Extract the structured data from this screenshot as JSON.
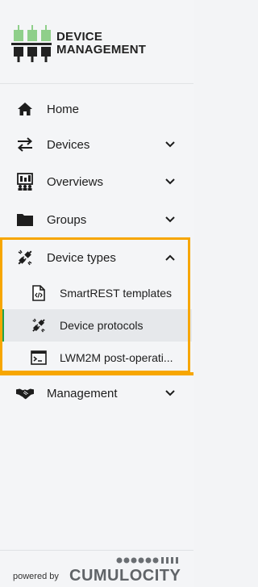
{
  "brand": {
    "line1": "DEVICE",
    "line2": "MANAGEMENT"
  },
  "nav": {
    "home": "Home",
    "devices": "Devices",
    "overviews": "Overviews",
    "groups": "Groups",
    "device_types": "Device types",
    "management": "Management"
  },
  "sub": {
    "smartrest": "SmartREST templates",
    "protocols": "Device protocols",
    "lwm2m": "LWM2M post-operati..."
  },
  "footer": {
    "powered_by": "powered by",
    "logo_word": "CUMULOCITY"
  },
  "colors": {
    "accent": "#22a34a",
    "highlight": "#f7a600",
    "logo_green": "#8fcf8a"
  }
}
